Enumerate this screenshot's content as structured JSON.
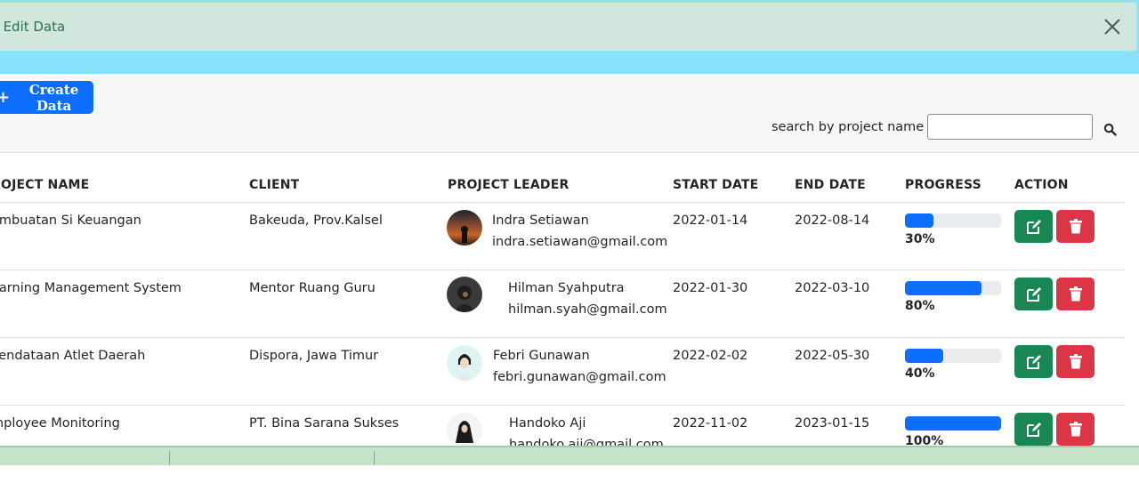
{
  "alert": {
    "text": "s Edit Data",
    "close_icon": "close-icon"
  },
  "toolbar": {
    "create_label": "Create Data",
    "create_icon": "+"
  },
  "search": {
    "label": "search by project name :",
    "value": "",
    "placeholder": ""
  },
  "table": {
    "headers": [
      "ROJECT NAME",
      "CLIENT",
      "PROJECT LEADER",
      "START DATE",
      "END DATE",
      "PROGRESS",
      "ACTION"
    ],
    "rows": [
      {
        "project": "embuatan Si Keuangan",
        "client": "Bakeuda, Prov.Kalsel",
        "leader_name": "Indra Setiawan",
        "leader_email": "indra.setiawan@gmail.com",
        "start": "2022-01-14",
        "end": "2022-08-14",
        "progress": 0.3,
        "progress_label": "30%"
      },
      {
        "project": "earning Management System",
        "client": "Mentor Ruang Guru",
        "leader_name": "Hilman Syahputra",
        "leader_email": "hilman.syah@gmail.com",
        "start": "2022-01-30",
        "end": "2022-03-10",
        "progress": 0.8,
        "progress_label": "80%"
      },
      {
        "project": " Pendataan Atlet Daerah",
        "client": "Dispora, Jawa Timur",
        "leader_name": "Febri Gunawan",
        "leader_email": "febri.gunawan@gmail.com",
        "start": "2022-02-02",
        "end": "2022-05-30",
        "progress": 0.4,
        "progress_label": "40%"
      },
      {
        "project": "mployee Monitoring",
        "client": "PT. Bina Sarana Sukses",
        "leader_name": "Handoko Aji",
        "leader_email": "handoko.aji@gmail.com",
        "start": "2022-11-02",
        "end": "2023-01-15",
        "progress": 1.0,
        "progress_label": "100%"
      }
    ]
  },
  "colors": {
    "accent": "#0d6efd",
    "edit": "#198754",
    "delete": "#dc3545",
    "alert_bg": "#d1e7dd",
    "page_bg": "#87e3fb"
  }
}
